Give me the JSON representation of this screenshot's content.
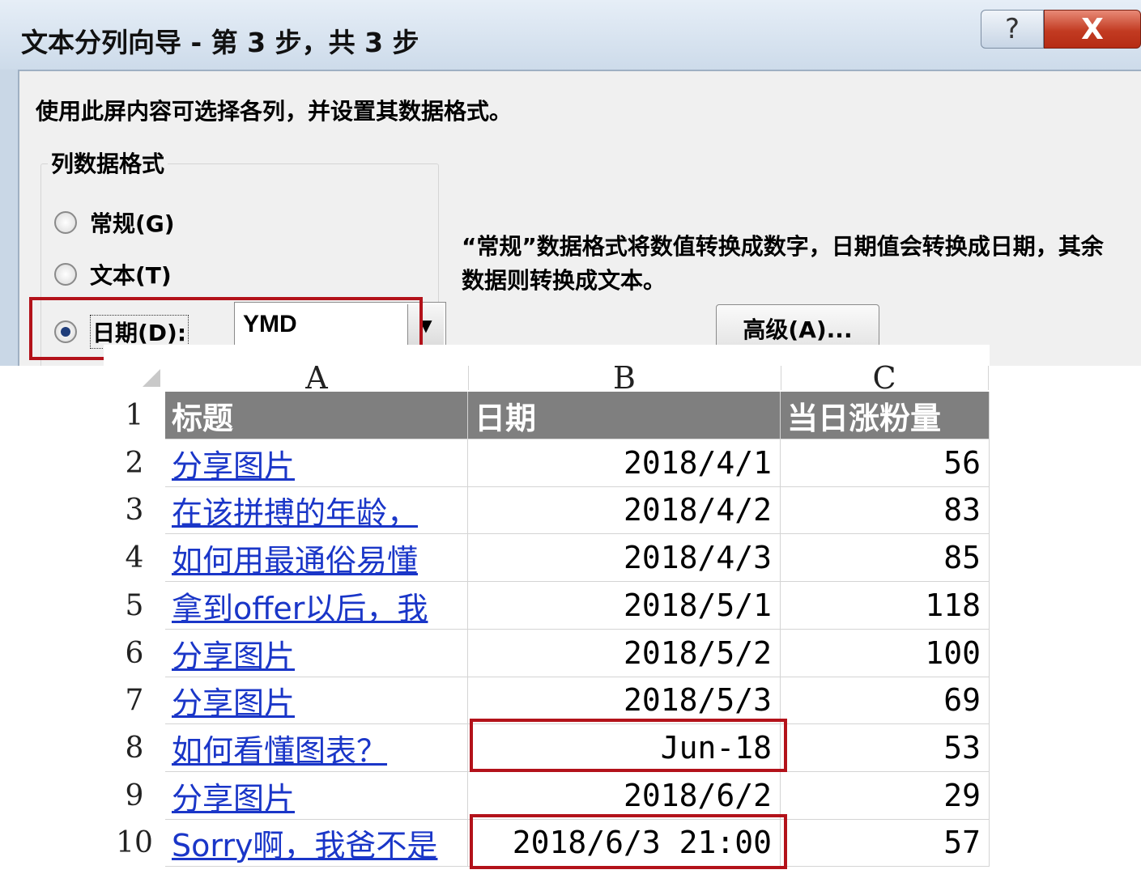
{
  "dialog": {
    "title": "文本分列向导 - 第 3 步，共 3 步",
    "help_label": "?",
    "close_label": "X",
    "instruction": "使用此屏内容可选择各列，并设置其数据格式。",
    "group_label": "列数据格式",
    "options": [
      {
        "label": "常规(G)",
        "checked": false
      },
      {
        "label": "文本(T)",
        "checked": false
      },
      {
        "label": "日期(D):",
        "checked": true
      }
    ],
    "date_format_value": "YMD",
    "description": "“常规”数据格式将数值转换成数字，日期值会转换成日期，其余数据则转换成文本。",
    "advanced_label": "高级(A)..."
  },
  "sheet": {
    "columns": [
      "A",
      "B",
      "C"
    ],
    "header": [
      "标题",
      "日期",
      "当日涨粉量"
    ],
    "rows": [
      {
        "num": "1"
      },
      {
        "num": "2",
        "title": "分享图片",
        "date": "2018/4/1",
        "count": "56"
      },
      {
        "num": "3",
        "title": "在该拼搏的年龄，",
        "date": "2018/4/2",
        "count": "83"
      },
      {
        "num": "4",
        "title": "如何用最通俗易懂",
        "date": "2018/4/3",
        "count": "85"
      },
      {
        "num": "5",
        "title": "拿到offer以后，我",
        "date": "2018/5/1",
        "count": "118"
      },
      {
        "num": "6",
        "title": "分享图片",
        "date": "2018/5/2",
        "count": "100"
      },
      {
        "num": "7",
        "title": "分享图片",
        "date": "2018/5/3",
        "count": "69"
      },
      {
        "num": "8",
        "title": "如何看懂图表？",
        "date": "Jun-18",
        "count": "53"
      },
      {
        "num": "9",
        "title": "分享图片",
        "date": "2018/6/2",
        "count": "29"
      },
      {
        "num": "10",
        "title": "Sorry啊，我爸不是",
        "date": "2018/6/3  21:00",
        "count": "57"
      }
    ]
  },
  "colors": {
    "highlight": "#b3121a",
    "header_fill": "#7f7f7f",
    "link": "#1a36c8"
  }
}
